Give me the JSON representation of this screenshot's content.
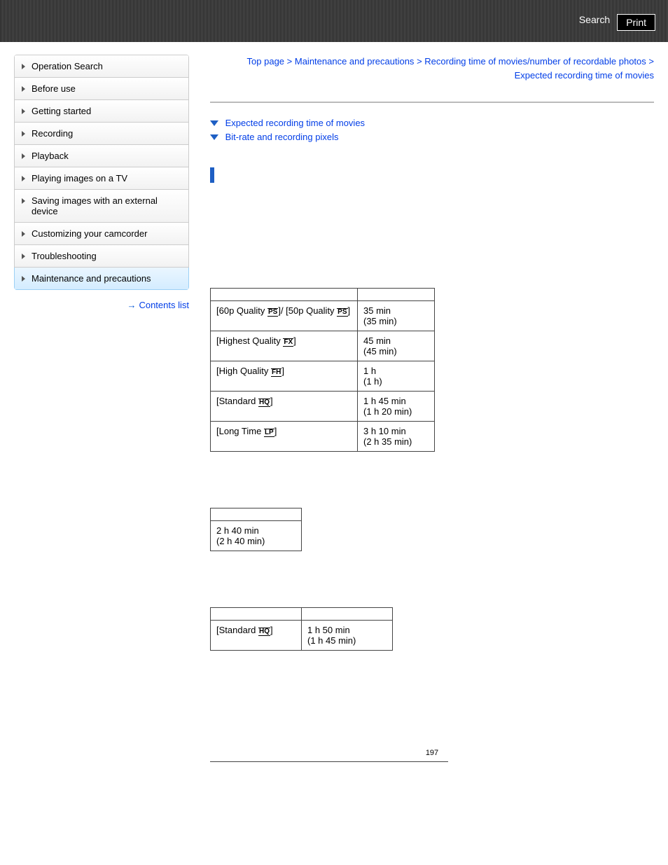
{
  "header": {
    "search": "Search",
    "print": "Print"
  },
  "sidebar": {
    "items": [
      "Operation Search",
      "Before use",
      "Getting started",
      "Recording",
      "Playback",
      "Playing images on a TV",
      "Saving images with an external device",
      "Customizing your camcorder",
      "Troubleshooting",
      "Maintenance and precautions"
    ],
    "contents_list": "Contents list"
  },
  "breadcrumb": {
    "top": "Top page",
    "a": "Maintenance and precautions",
    "b": "Recording time of movies/number of recordable photos",
    "c": "Expected recording time of movies"
  },
  "anchors": {
    "a": "Expected recording time of movies",
    "b": "Bit-rate and recording pixels"
  },
  "table1": {
    "rows": [
      {
        "mode_prefix": "[60p Quality ",
        "icon": "PS",
        "mode_mid": "]/ [50p Quality ",
        "icon2": "PS",
        "mode_suffix": "]",
        "time_a": "35 min",
        "time_b": "(35 min)"
      },
      {
        "mode_prefix": "[Highest Quality ",
        "icon": "FX",
        "mode_suffix": "]",
        "time_a": "45 min",
        "time_b": "(45 min)"
      },
      {
        "mode_prefix": "[High Quality ",
        "icon": "FH",
        "mode_suffix": "]",
        "time_a": "1 h",
        "time_b": "(1 h)"
      },
      {
        "mode_prefix": "[Standard ",
        "icon": "HQ",
        "mode_suffix": "]",
        "time_a": "1 h 45 min",
        "time_b": "(1 h 20 min)"
      },
      {
        "mode_prefix": "[Long Time ",
        "icon": "LP",
        "mode_suffix": "]",
        "time_a": "3 h 10 min",
        "time_b": "(2 h 35 min)"
      }
    ]
  },
  "table2": {
    "time_a": "2 h 40 min",
    "time_b": "(2 h 40 min)"
  },
  "table3": {
    "mode_prefix": "[Standard ",
    "icon": "HQ",
    "mode_suffix": "]",
    "time_a": "1 h 50 min",
    "time_b": "(1 h 45 min)"
  },
  "pagenum": "197"
}
